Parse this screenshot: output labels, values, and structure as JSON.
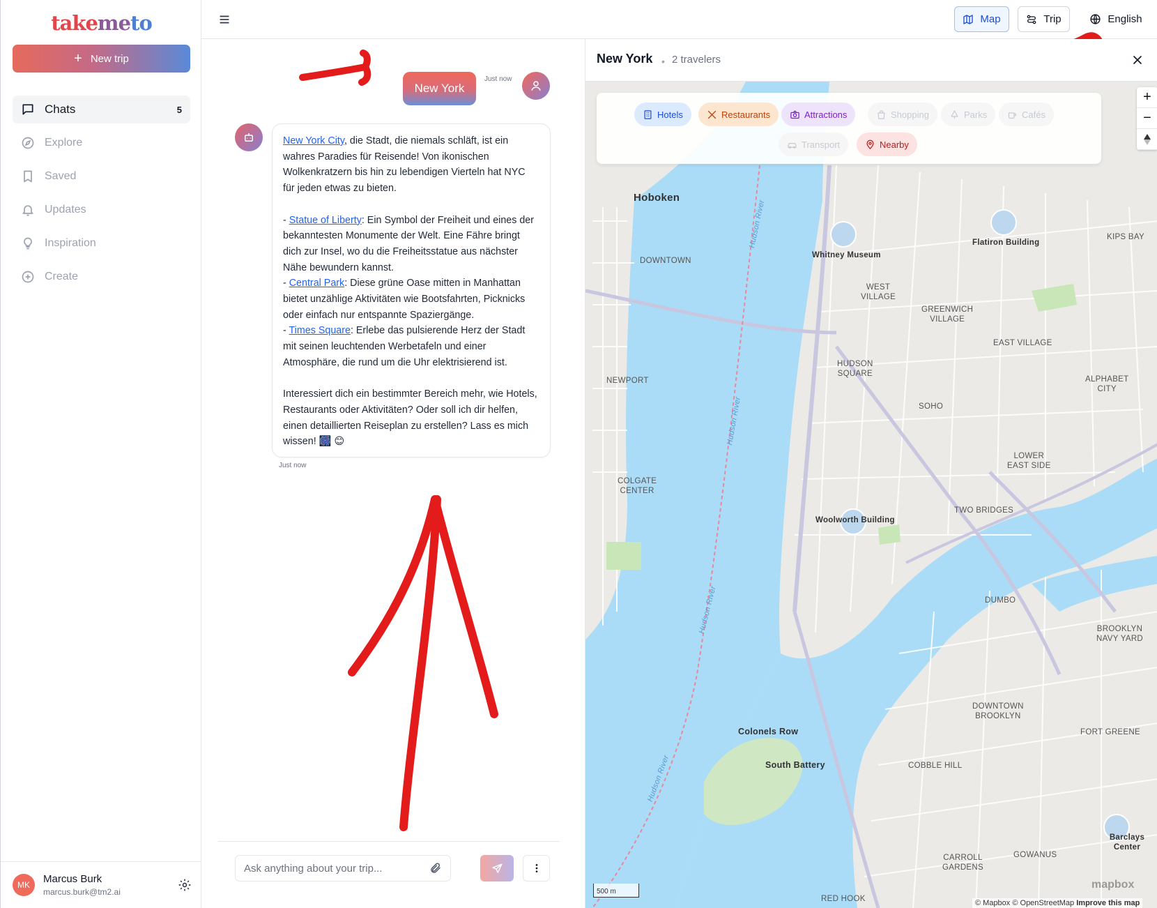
{
  "app": {
    "logo_part1": "take",
    "logo_part2": "me",
    "logo_part3": "to"
  },
  "sidebar": {
    "new_trip_label": "New trip",
    "items": [
      {
        "label": "Chats",
        "icon": "chat-bubble-icon",
        "count": "5",
        "active": true
      },
      {
        "label": "Explore",
        "icon": "compass-icon"
      },
      {
        "label": "Saved",
        "icon": "bookmark-icon"
      },
      {
        "label": "Updates",
        "icon": "bell-icon"
      },
      {
        "label": "Inspiration",
        "icon": "lightbulb-icon"
      },
      {
        "label": "Create",
        "icon": "plus-circle-icon"
      }
    ],
    "user": {
      "initials": "MK",
      "name": "Marcus Burk",
      "email": "marcus.burk@tm2.ai"
    }
  },
  "topbar": {
    "map_label": "Map",
    "trip_label": "Trip",
    "language_label": "English"
  },
  "chat": {
    "user_message": "New York",
    "user_time": "Just now",
    "bot_time": "Just now",
    "bot": {
      "intro_link": "New York City",
      "intro_text": ", die Stadt, die niemals schläft, ist ein wahres Paradies für Reisende! Von ikonischen Wolkenkratzern bis hin zu lebendigen Vierteln hat NYC für jeden etwas zu bieten.",
      "items": [
        {
          "prefix": "- ",
          "link": "Statue of Liberty",
          "text": ": Ein Symbol der Freiheit und eines der bekanntesten Monumente der Welt. Eine Fähre bringt dich zur Insel, wo du die Freiheitsstatue aus nächster Nähe bewundern kannst."
        },
        {
          "prefix": "- ",
          "link": "Central Park",
          "text": ": Diese grüne Oase mitten in Manhattan bietet unzählige Aktivitäten wie Bootsfahrten, Picknicks oder einfach nur entspannte Spaziergänge."
        },
        {
          "prefix": "- ",
          "link": "Times Square",
          "text": ": Erlebe das pulsierende Herz der Stadt mit seinen leuchtenden Werbetafeln und einer Atmosphäre, die rund um die Uhr elektrisierend ist."
        }
      ],
      "closing": "Interessiert dich ein bestimmter Bereich mehr, wie Hotels, Restaurants oder Aktivitäten? Oder soll ich dir helfen, einen detaillierten Reiseplan zu erstellen? Lass es mich wissen! 🎆 😊"
    },
    "composer_placeholder": "Ask anything about your trip..."
  },
  "map_panel": {
    "title": "New York",
    "separator": "•",
    "subtitle": "2 travelers",
    "filters": [
      {
        "label": "Hotels",
        "icon": "building-icon",
        "active": true
      },
      {
        "label": "Restaurants",
        "icon": "utensils-icon",
        "active": true
      },
      {
        "label": "Attractions",
        "icon": "camera-icon",
        "active": true
      },
      {
        "label": "Shopping",
        "icon": "shopping-bag-icon",
        "active": false
      },
      {
        "label": "Parks",
        "icon": "tree-icon",
        "active": false
      },
      {
        "label": "Cafés",
        "icon": "coffee-icon",
        "active": false
      },
      {
        "label": "Transport",
        "icon": "car-icon",
        "active": false
      },
      {
        "label": "Nearby",
        "icon": "map-pin-icon",
        "active": true
      }
    ],
    "zoom_in": "+",
    "zoom_out": "−",
    "scale_label": "500 m",
    "attribution_1": "© Mapbox © OpenStreetMap",
    "attribution_2": "Improve this map",
    "mapbox_logo": "mapbox",
    "labels": {
      "hoboken": "Hoboken",
      "downtown": "DOWNTOWN",
      "whitney": "Whitney Museum",
      "flatiron": "Flatiron Building",
      "kips_bay": "KIPS BAY",
      "west_village": "WEST\nVILLAGE",
      "greenwich": "GREENWICH\nVILLAGE",
      "east_village": "EAST VILLAGE",
      "hudson_sq": "HUDSON\nSQUARE",
      "newport": "NEWPORT",
      "alphabet_city": "ALPHABET\nCITY",
      "soho": "SOHO",
      "lower_east": "LOWER\nEAST SIDE",
      "colgate": "COLGATE\nCENTER",
      "woolworth": "Woolworth Building",
      "two_bridges": "TWO BRIDGES",
      "dumbo": "DUMBO",
      "brooklyn_navy": "BROOKLYN\nNAVY YARD",
      "downtown_bk": "DOWNTOWN\nBROOKLYN",
      "fort_greene": "FORT GREENE",
      "colonels_row": "Colonels Row",
      "south_battery": "South Battery",
      "cobble_hill": "COBBLE HILL",
      "barclays": "Barclays Center",
      "carroll": "CARROLL\nGARDENS",
      "gowanus": "GOWANUS",
      "red_hook": "RED HOOK",
      "hudson_river": "Hudson River"
    }
  }
}
